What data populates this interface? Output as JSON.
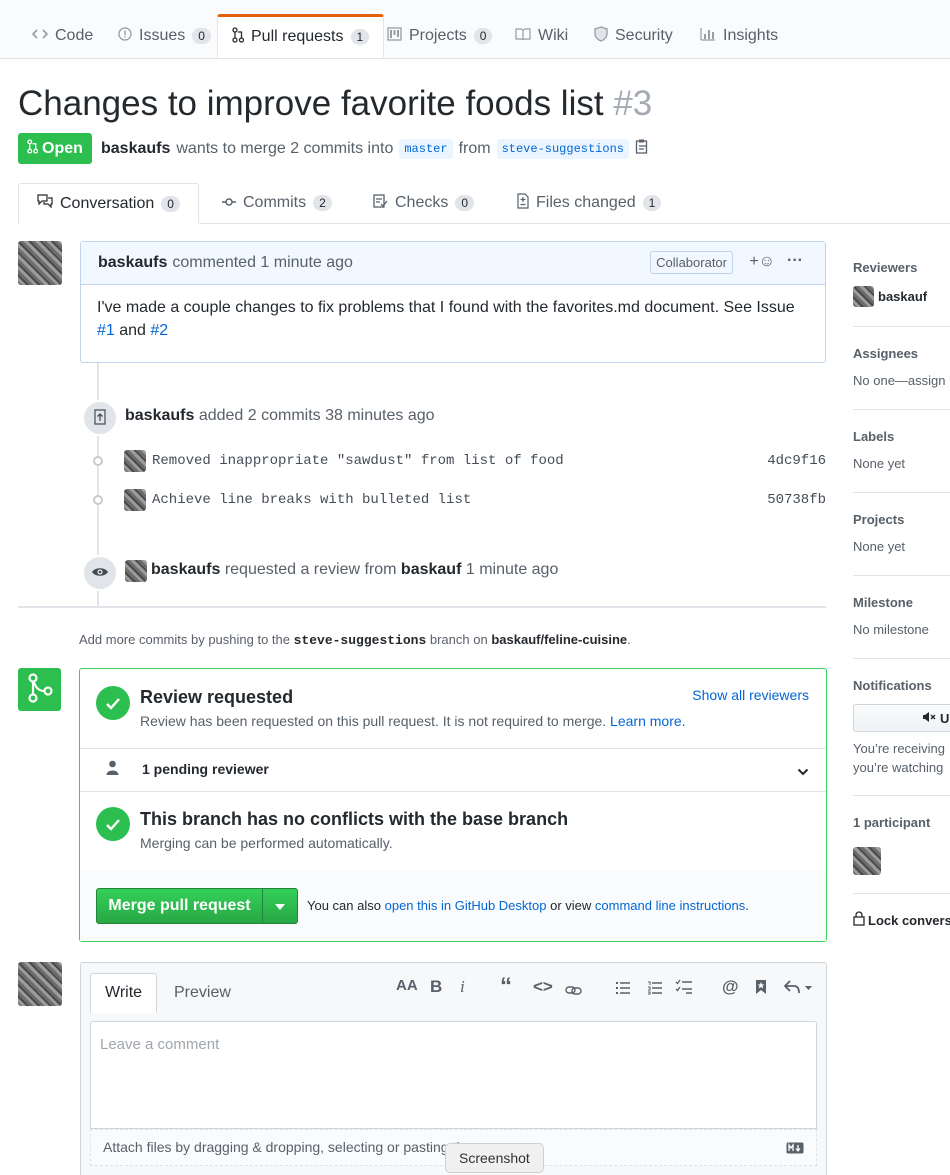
{
  "repo_nav": {
    "tabs": [
      {
        "label": "Code",
        "icon": "code-icon"
      },
      {
        "label": "Issues",
        "count": "0",
        "icon": "issue-opened-icon"
      },
      {
        "label": "Pull requests",
        "count": "1",
        "icon": "git-pull-request-icon"
      },
      {
        "label": "Projects",
        "count": "0",
        "icon": "project-icon"
      },
      {
        "label": "Wiki",
        "icon": "book-icon"
      },
      {
        "label": "Security",
        "icon": "shield-icon"
      },
      {
        "label": "Insights",
        "icon": "graph-icon"
      }
    ],
    "active": "Pull requests"
  },
  "pr": {
    "title": "Changes to improve favorite foods list",
    "number": "#3",
    "state": "Open",
    "author": "baskaufs",
    "meta_text": "wants to merge 2 commits into",
    "base_branch": "master",
    "from_text": "from",
    "head_branch": "steve-suggestions"
  },
  "pr_tabs": [
    {
      "label": "Conversation",
      "count": "0"
    },
    {
      "label": "Commits",
      "count": "2"
    },
    {
      "label": "Checks",
      "count": "0"
    },
    {
      "label": "Files changed",
      "count": "1"
    }
  ],
  "comment": {
    "author": "baskaufs",
    "action": "commented 1 minute ago",
    "role": "Collaborator",
    "reaction": "+☺",
    "more": "···",
    "body_text": "I've made a couple changes to fix problems that I found with the favorites.md document. See Issue",
    "link1": "#1",
    "and": "and",
    "link2": "#2"
  },
  "timeline": {
    "commits_event": {
      "actor": "baskaufs",
      "text": "added 2 commits 38 minutes ago"
    },
    "commits": [
      {
        "message": "Removed inappropriate \"sawdust\" from list of food",
        "sha": "4dc9f16"
      },
      {
        "message": "Achieve line breaks with bulleted list",
        "sha": "50738fb"
      }
    ],
    "review_event": {
      "actor": "baskaufs",
      "text": "requested a review from",
      "reviewer": "baskauf",
      "time": "1 minute ago"
    }
  },
  "push_hint": {
    "prefix": "Add more commits by pushing to the",
    "branch": "steve-suggestions",
    "middle": "branch on",
    "repo": "baskauf/feline-cuisine",
    "suffix": "."
  },
  "merge_box": {
    "review_title": "Review requested",
    "review_sub": "Review has been requested on this pull request. It is not required to merge.",
    "learn_more": "Learn more.",
    "show_all": "Show all reviewers",
    "pending": "1 pending reviewer",
    "conflicts_title": "This branch has no conflicts with the base branch",
    "conflicts_sub": "Merging can be performed automatically.",
    "merge_button": "Merge pull request",
    "also_text": "You can also",
    "desktop_link": "open this in GitHub Desktop",
    "or_view": "or view",
    "cli_link": "command line instructions",
    "period": "."
  },
  "sidebar": {
    "reviewers": {
      "heading": "Reviewers",
      "value": "baskauf"
    },
    "assignees": {
      "heading": "Assignees",
      "value": "No one—assign"
    },
    "labels": {
      "heading": "Labels",
      "value": "None yet"
    },
    "projects": {
      "heading": "Projects",
      "value": "None yet"
    },
    "milestone": {
      "heading": "Milestone",
      "value": "No milestone"
    },
    "notifications": {
      "heading": "Notifications",
      "button": "U",
      "line1": "You’re receiving",
      "line2": "you’re watching"
    },
    "participants": {
      "heading": "1 participant"
    },
    "lock": "Lock convers"
  },
  "form": {
    "write_tab": "Write",
    "preview_tab": "Preview",
    "placeholder": "Leave a comment",
    "attach": "Attach files by dragging & dropping, selecting or pasting them.",
    "tooltip": "Screenshot"
  },
  "colors": {
    "open_green": "#2cbe4e",
    "link_blue": "#0366d6",
    "active_tab_orange": "#e36209"
  }
}
